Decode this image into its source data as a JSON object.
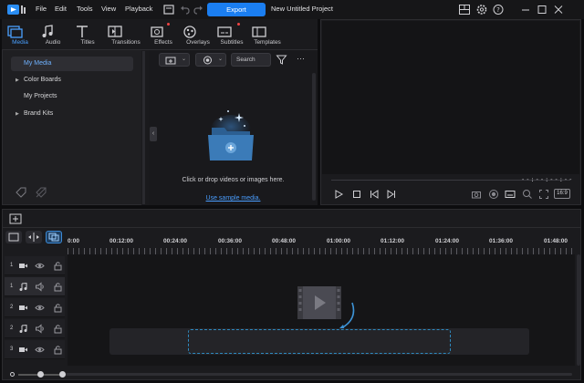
{
  "menu": [
    "File",
    "Edit",
    "Tools",
    "View",
    "Playback"
  ],
  "export_label": "Export",
  "document_title": "New Untitled Project",
  "rooms": [
    {
      "label": "Media",
      "active": true
    },
    {
      "label": "Audio"
    },
    {
      "label": "Titles"
    },
    {
      "label": "Transitions"
    },
    {
      "label": "Effects",
      "badge": true
    },
    {
      "label": "Overlays"
    },
    {
      "label": "Subtitles",
      "badge": true
    },
    {
      "label": "Templates"
    }
  ],
  "library_tree": [
    {
      "label": "My Media",
      "selected": true,
      "expandable": false
    },
    {
      "label": "Color Boards",
      "expandable": true
    },
    {
      "label": "My Projects",
      "expandable": false
    },
    {
      "label": "Brand Kits",
      "expandable": true
    }
  ],
  "search_placeholder": "Search",
  "drop_hint": "Click or drop videos or images here.",
  "sample_link": "Use sample media.",
  "preview": {
    "timecode": "--:--:--:--",
    "aspect_ratio": "16:9"
  },
  "timeline": {
    "ticks": [
      "0:00",
      "00:12:00",
      "00:24:00",
      "00:36:00",
      "00:48:00",
      "01:00:00",
      "01:12:00",
      "01:24:00",
      "01:36:00",
      "01:48:00"
    ],
    "tracks": [
      {
        "number": "1",
        "type": "video"
      },
      {
        "number": "1",
        "type": "audio"
      },
      {
        "number": "2",
        "type": "video"
      },
      {
        "number": "2",
        "type": "audio"
      },
      {
        "number": "3",
        "type": "video"
      }
    ]
  },
  "colors": {
    "accent": "#1b7ef0",
    "link": "#4a9eff",
    "active_room": "#4aa0ff",
    "badge": "#e44444"
  }
}
